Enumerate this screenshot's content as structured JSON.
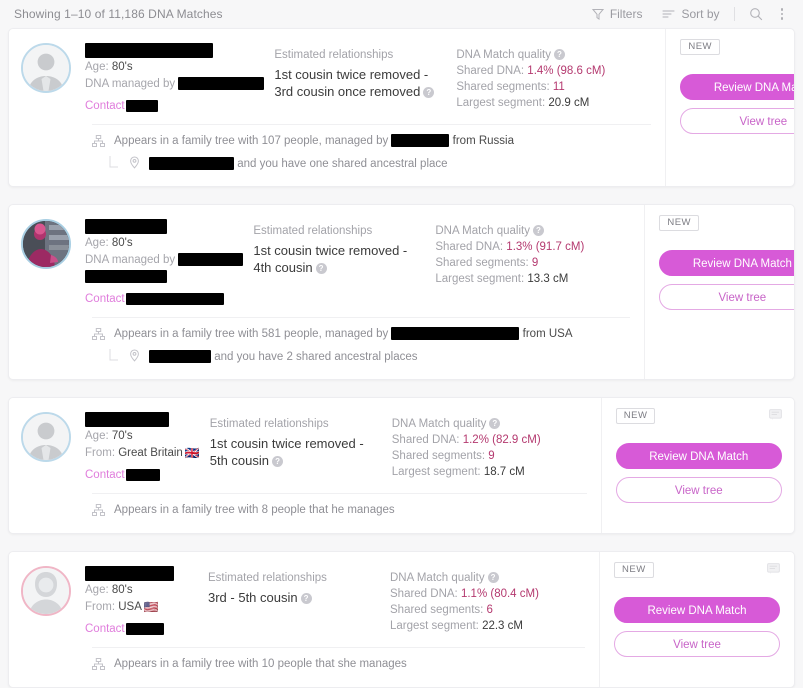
{
  "toolbar": {
    "showing": "Showing 1–10 of 11,186 DNA Matches",
    "filters_label": "Filters",
    "sort_label": "Sort by",
    "filters_icon": "funnel-icon",
    "sort_icon": "sort-lines-icon",
    "search_icon": "search-icon",
    "more_icon": "more-vertical-icon"
  },
  "labels": {
    "estimated_relationships": "Estimated relationships",
    "dna_match_quality": "DNA Match quality",
    "shared_dna": "Shared DNA:",
    "shared_segments": "Shared segments:",
    "largest_segment": "Largest segment:",
    "age_prefix": "Age:",
    "from_prefix": "From:",
    "managed_by": "DNA managed by",
    "contact": "Contact",
    "new_badge": "NEW",
    "review_button": "Review DNA Match",
    "view_tree_button": "View tree",
    "help_glyph": "?"
  },
  "colors": {
    "accent": "#d75ad7",
    "link": "#e07ddc",
    "value": "#b4396f",
    "page_bg": "#f7f7f8"
  },
  "matches": [
    {
      "avatar_type": "male-silhouette",
      "name_redacted": true,
      "name_bar_width": 128,
      "age": "80's",
      "from": null,
      "flag": null,
      "managed_by_redacted_width": 86,
      "managed_by_second_line_width": 0,
      "contact_redacted_width": 32,
      "relationship": "1st cousin twice removed - 3rd cousin once removed",
      "shared_dna": "1.4% (98.6 cM)",
      "shared_segments": "11",
      "largest_segment": "20.9 cM",
      "is_new": true,
      "tree_text_before": "Appears in a family tree with 107 people, managed by",
      "tree_manager_redacted_width": 58,
      "tree_text_after": "from Russia",
      "place_redacted_width": 85,
      "place_text": "and you have one shared ancestral place",
      "has_place_row": true
    },
    {
      "avatar_type": "photo",
      "name_redacted": true,
      "name_bar_width": 82,
      "age": "80's",
      "from": null,
      "flag": null,
      "managed_by_redacted_width": 65,
      "managed_by_second_line_width": 82,
      "contact_redacted_width": 98,
      "relationship": "1st cousin twice removed - 4th cousin",
      "shared_dna": "1.3% (91.7 cM)",
      "shared_segments": "9",
      "largest_segment": "13.3 cM",
      "is_new": true,
      "tree_text_before": "Appears in a family tree with 581 people, managed by",
      "tree_manager_redacted_width": 128,
      "tree_text_after": "from USA",
      "place_redacted_width": 62,
      "place_text": "and you have 2 shared ancestral places",
      "has_place_row": true
    },
    {
      "avatar_type": "male-silhouette",
      "name_redacted": true,
      "name_bar_width": 84,
      "age": "70's",
      "from": "Great Britain",
      "flag": "🇬🇧",
      "managed_by_redacted_width": 0,
      "managed_by_second_line_width": 0,
      "contact_redacted_width": 34,
      "relationship": "1st cousin twice removed - 5th cousin",
      "shared_dna": "1.2% (82.9 cM)",
      "shared_segments": "9",
      "largest_segment": "18.7 cM",
      "is_new": true,
      "tree_text_before": "Appears in a family tree with 8 people that he manages",
      "tree_manager_redacted_width": 0,
      "tree_text_after": "",
      "place_redacted_width": 0,
      "place_text": "",
      "has_place_row": false
    },
    {
      "avatar_type": "female-silhouette",
      "name_redacted": true,
      "name_bar_width": 89,
      "age": "80's",
      "from": "USA",
      "flag": "🇺🇸",
      "managed_by_redacted_width": 0,
      "managed_by_second_line_width": 0,
      "contact_redacted_width": 38,
      "relationship": "3rd - 5th cousin",
      "shared_dna": "1.1% (80.4 cM)",
      "shared_segments": "6",
      "largest_segment": "22.3 cM",
      "is_new": true,
      "tree_text_before": "Appears in a family tree with 10 people that she manages",
      "tree_manager_redacted_width": 0,
      "tree_text_after": "",
      "place_redacted_width": 0,
      "place_text": "",
      "has_place_row": false
    }
  ]
}
